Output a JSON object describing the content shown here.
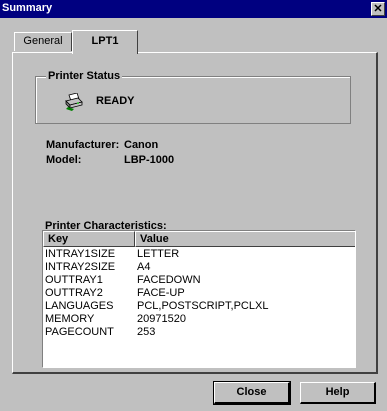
{
  "window": {
    "title": "Summary",
    "close_glyph": "✕"
  },
  "tabs": [
    {
      "label": "General"
    },
    {
      "label": "LPT1"
    }
  ],
  "status_group": {
    "legend": "Printer Status",
    "icon": "printer-icon",
    "status": "READY"
  },
  "info": {
    "manufacturer_label": "Manufacturer:",
    "manufacturer_value": "Canon",
    "model_label": "Model:",
    "model_value": "LBP-1000"
  },
  "characteristics": {
    "label": "Printer Characteristics:",
    "columns": {
      "key": "Key",
      "value": "Value"
    },
    "rows": [
      {
        "key": "INTRAY1SIZE",
        "value": "LETTER"
      },
      {
        "key": "INTRAY2SIZE",
        "value": "A4"
      },
      {
        "key": "OUTTRAY1",
        "value": "FACEDOWN"
      },
      {
        "key": "OUTTRAY2",
        "value": "FACE-UP"
      },
      {
        "key": "LANGUAGES",
        "value": "PCL,POSTSCRIPT,PCLXL"
      },
      {
        "key": "MEMORY",
        "value": "20971520"
      },
      {
        "key": "PAGECOUNT",
        "value": "253"
      }
    ]
  },
  "buttons": {
    "close": "Close",
    "help": "Help"
  },
  "colors": {
    "titlebar": "#000080",
    "face": "#c0c0c0"
  }
}
